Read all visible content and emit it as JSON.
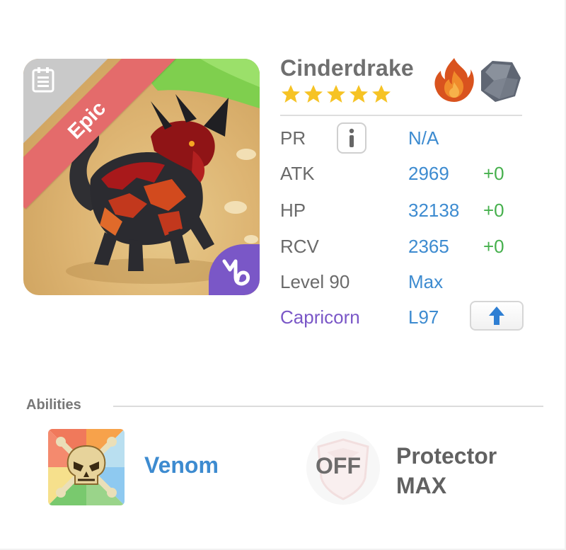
{
  "creature": {
    "name": "Cinderdrake",
    "rarity": "Epic",
    "stars": 5,
    "elements": [
      "fire",
      "rock"
    ]
  },
  "stats": {
    "pr": {
      "label": "PR",
      "value": "N/A"
    },
    "atk": {
      "label": "ATK",
      "value": "2969",
      "bonus": "+0"
    },
    "hp": {
      "label": "HP",
      "value": "32138",
      "bonus": "+0"
    },
    "rcv": {
      "label": "RCV",
      "value": "2365",
      "bonus": "+0"
    },
    "level": {
      "label": "Level 90",
      "value": "Max"
    },
    "zodiac": {
      "label": "Capricorn",
      "value": "L97"
    }
  },
  "abilities": {
    "title": "Abilities",
    "active": {
      "name": "Venom",
      "icon": "skull-crossbones-icon"
    },
    "passive": {
      "state": "OFF",
      "name_line1": "Protector",
      "name_line2": "MAX",
      "icon": "shield-icon"
    }
  },
  "colors": {
    "link_blue": "#3d8bd0",
    "bonus_green": "#46b04d",
    "zodiac_purple": "#7a57c7",
    "epic_red": "#e46b6b",
    "star_yellow": "#f6c325"
  }
}
